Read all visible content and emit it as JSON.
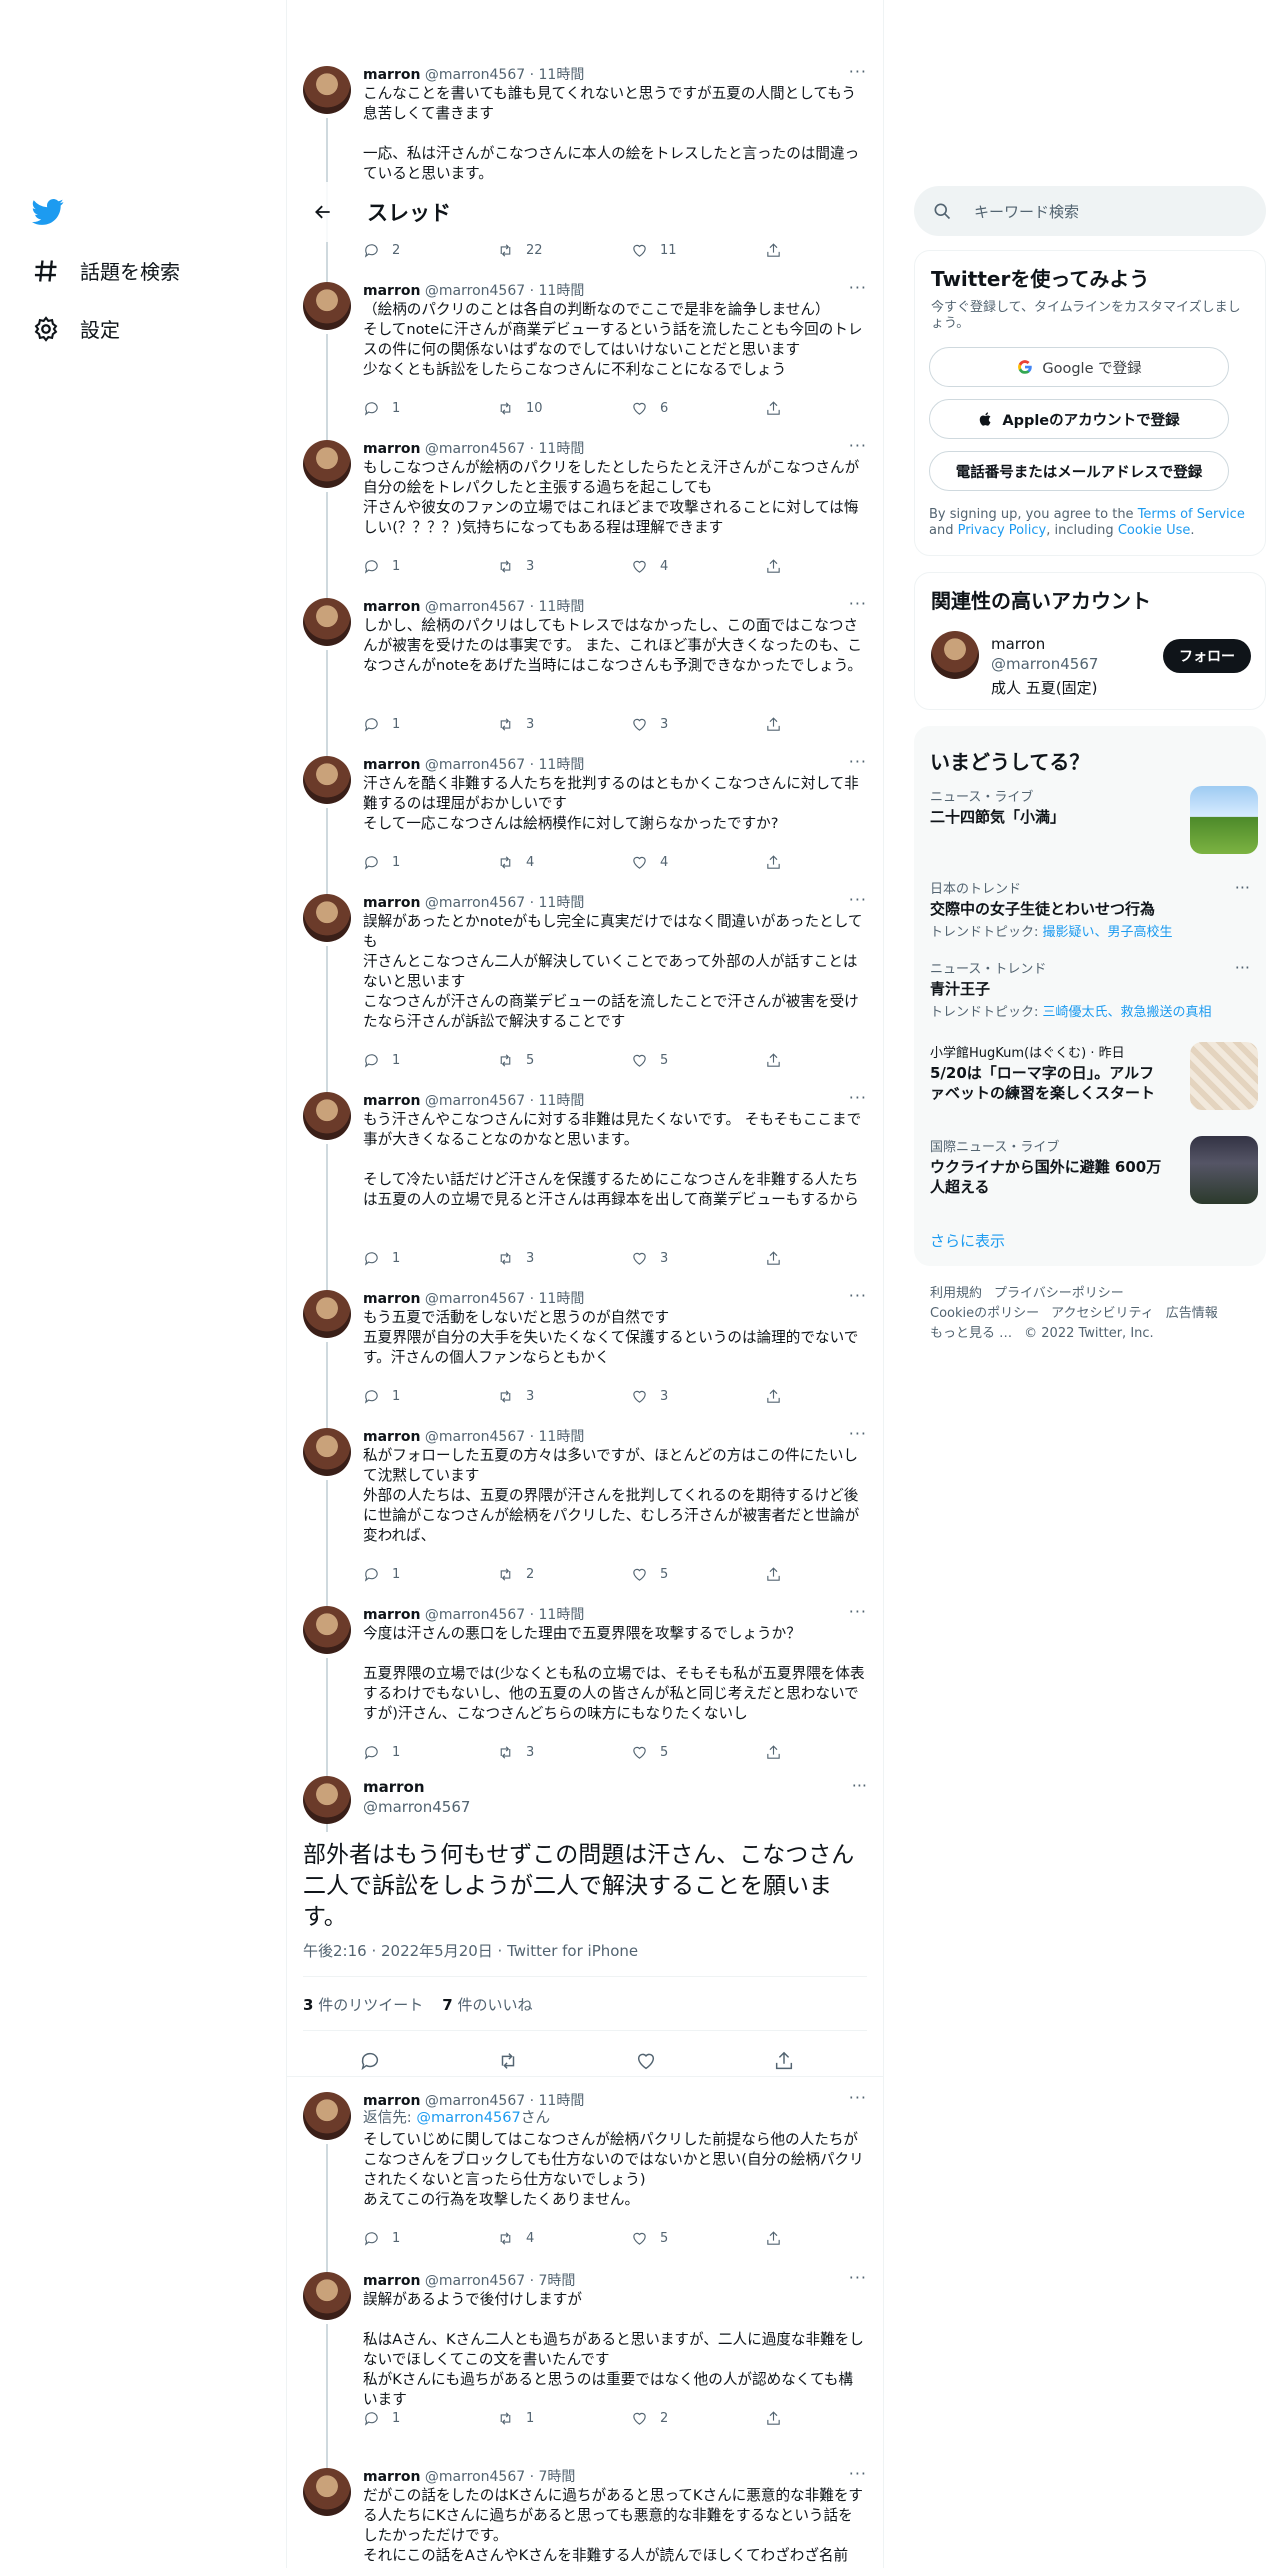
{
  "nav": {
    "items": [
      {
        "label": "話題を検索"
      },
      {
        "label": "設定"
      }
    ]
  },
  "header": {
    "title": "スレッド"
  },
  "tweets": [
    {
      "name": "marron",
      "handle": "@marron4567",
      "time": "11時間",
      "text": "こんなことを書いても誰も見てくれないと思うですが五夏の人間としてもう息苦しくて書きます\n\n一応、私は汗さんがこなつさんに本人の絵をトレスしたと言ったのは間違っていると思います。",
      "reply": "2",
      "retweet": "22",
      "like": "11"
    },
    {
      "name": "marron",
      "handle": "@marron4567",
      "time": "11時間",
      "text": "（絵柄のパクリのことは各自の判断なのでここで是非を論争しません）\nそしてnoteに汗さんが商業デビューするという話を流したことも今回のトレスの件に何の関係ないはずなのでしてはいけないことだと思います\n少なくとも訴訟をしたらこなつさんに不利なことになるでしょう",
      "reply": "1",
      "retweet": "10",
      "like": "6"
    },
    {
      "name": "marron",
      "handle": "@marron4567",
      "time": "11時間",
      "text": "もしこなつさんが絵柄のパクリをしたとしたらたとえ汗さんがこなつさんが自分の絵をトレパクしたと主張する過ちを起こしても\n汗さんや彼女のファンの立場ではこれほどまで攻撃されることに対しては悔しい(？？？？)気持ちになってもある程は理解できます",
      "reply": "1",
      "retweet": "3",
      "like": "4"
    },
    {
      "name": "marron",
      "handle": "@marron4567",
      "time": "11時間",
      "text": "しかし、絵柄のパクリはしてもトレスではなかったし、この面ではこなつさんが被害を受けたのは事実です。 また、これほど事が大きくなったのも、こなつさんがnoteをあげた当時にはこなつさんも予測できなかったでしょう。",
      "reply": "1",
      "retweet": "3",
      "like": "3"
    },
    {
      "name": "marron",
      "handle": "@marron4567",
      "time": "11時間",
      "text": "汗さんを酷く非難する人たちを批判するのはともかくこなつさんに対して非難するのは理屈がおかしいです\nそして一応こなつさんは絵柄模作に対して謝らなかったですか?",
      "reply": "1",
      "retweet": "4",
      "like": "4"
    },
    {
      "name": "marron",
      "handle": "@marron4567",
      "time": "11時間",
      "text": "誤解があったとかnoteがもし完全に真実だけではなく間違いがあったとしても\n汗さんとこなつさん二人が解決していくことであって外部の人が話すことはないと思います\nこなつさんが汗さんの商業デビューの話を流したことで汗さんが被害を受けたなら汗さんが訴訟で解決することです",
      "reply": "1",
      "retweet": "5",
      "like": "5"
    },
    {
      "name": "marron",
      "handle": "@marron4567",
      "time": "11時間",
      "text": "もう汗さんやこなつさんに対する非難は見たくないです。 そもそもここまで事が大きくなることなのかなと思います。\n\nそして冷たい話だけど汗さんを保護するためにこなつさんを非難する人たちは五夏の人の立場で見ると汗さんは再録本を出して商業デビューもするから",
      "reply": "1",
      "retweet": "3",
      "like": "3"
    },
    {
      "name": "marron",
      "handle": "@marron4567",
      "time": "11時間",
      "text": "もう五夏で活動をしないだと思うのが自然です\n五夏界隈が自分の大手を失いたくなくて保護するというのは論理的でないです。汗さんの個人ファンならともかく",
      "reply": "1",
      "retweet": "3",
      "like": "3"
    },
    {
      "name": "marron",
      "handle": "@marron4567",
      "time": "11時間",
      "text": "私がフォローした五夏の方々は多いですが、ほとんどの方はこの件にたいして沈黙しています\n外部の人たちは、五夏の界隈が汗さんを批判してくれるのを期待するけど後に世論がこなつさんが絵柄をパクリした、むしろ汗さんが被害者だと世論が変われば、",
      "reply": "1",
      "retweet": "2",
      "like": "5"
    },
    {
      "name": "marron",
      "handle": "@marron4567",
      "time": "11時間",
      "text": "今度は汗さんの悪口をした理由で五夏界隈を攻撃するでしょうか？\n\n五夏界隈の立場では(少なくとも私の立場では、そもそも私が五夏界隈を体表するわけでもないし、他の五夏の人の皆さんが私と同じ考えだと思わないですが)汗さん、こなつさんどちらの味方にもなりたくないし",
      "reply": "1",
      "retweet": "3",
      "like": "5"
    }
  ],
  "focus": {
    "name": "marron",
    "handle": "@marron4567",
    "text": "部外者はもう何もせずこの問題は汗さん、こなつさん二人で訴訟をしようが二人で解決することを願います。",
    "timestamp": "午後2:16 · 2022年5月20日 · Twitter for iPhone",
    "retweets_count": "3",
    "retweets_label": " 件のリツイート",
    "likes_count": "7",
    "likes_label": " 件のいいね"
  },
  "replies": [
    {
      "name": "marron",
      "handle": "@marron4567",
      "time": "11時間",
      "reply_to_label": "返信先: ",
      "reply_to": "@marron4567",
      "reply_to_suffix": "さん",
      "text": "そしていじめに関してはこなつさんが絵柄パクリした前提なら他の人たちがこなつさんをブロックしても仕方ないのではないかと思い(自分の絵柄パクリされたくないと言ったら仕方ないでしょう)\nあえてこの行為を攻撃したくありません。",
      "reply": "1",
      "retweet": "4",
      "like": "5"
    },
    {
      "name": "marron",
      "handle": "@marron4567",
      "time": "7時間",
      "text": "誤解があるようで後付けしますが\n\n私はAさん、Kさん二人とも過ちがあると思いますが、二人に過度な非難をしないでほしくてこの文を書いたんです\n私がKさんにも過ちがあると思うのは重要ではなく他の人が認めなくても構います",
      "reply": "1",
      "retweet": "1",
      "like": "2"
    },
    {
      "name": "marron",
      "handle": "@marron4567",
      "time": "7時間",
      "text": "だがこの話をしたのはKさんに過ちがあると思ってKさんに悪意的な非難をする人たちにKさんに過ちがあると思っても悪意的な非難をするなという話をしたかっただけです。\nそれにこの話をAさんやKさんを非難する人が読んでほしくてわざわざ名前",
      "reply": "",
      "retweet": "",
      "like": ""
    }
  ],
  "search": {
    "placeholder": "キーワード検索"
  },
  "signup": {
    "title": "Twitterを使ってみよう",
    "subtitle": "今すぐ登録して、タイムラインをカスタマイズしましょう。",
    "google": "Google で登録",
    "apple": "Appleのアカウントで登録",
    "phone": "電話番号またはメールアドレスで登録",
    "legal_pre": "By signing up, you agree to the ",
    "terms": "Terms of Service",
    "legal_and": " and ",
    "privacy": "Privacy Policy",
    "legal_incl": ", including ",
    "cookie": "Cookie Use",
    "legal_end": "."
  },
  "related": {
    "title": "関連性の高いアカウント",
    "name": "marron",
    "handle": "@marron4567",
    "bio": "成人 五夏(固定)",
    "follow": "フォロー"
  },
  "trends": {
    "title": "いまどうしてる？",
    "items": [
      {
        "category": "ニュース・ライブ",
        "title": "二十四節気「小満」",
        "topics_label": "",
        "topics": ""
      },
      {
        "category": "日本のトレンド",
        "title": "交際中の女子生徒とわいせつ行為",
        "topics_label": "トレンドトピック: ",
        "topics": "撮影疑い、男子高校生"
      },
      {
        "category": "ニュース・トレンド",
        "title": "青汁王子",
        "topics_label": "トレンドトピック: ",
        "topics": "三崎優太氏、救急搬送の真相"
      },
      {
        "category": "小学館HugKum(はぐくむ) · 昨日",
        "title": "5/20は「ローマ字の日」。アルファベットの練習を楽しくスタート",
        "topics_label": "",
        "topics": ""
      },
      {
        "category": "国際ニュース・ライブ",
        "title": "ウクライナから国外に避難 600万人超える",
        "topics_label": "",
        "topics": ""
      }
    ],
    "show_more": "さらに表示"
  },
  "footer": {
    "links": [
      "利用規約",
      "プライバシーポリシー",
      "Cookieのポリシー",
      "アクセシビリティ",
      "広告情報",
      "もっと見る …",
      "© 2022 Twitter, Inc."
    ]
  },
  "colors": {
    "accent": "#1d9bf0",
    "text": "#0f1419",
    "muted": "#536471"
  }
}
